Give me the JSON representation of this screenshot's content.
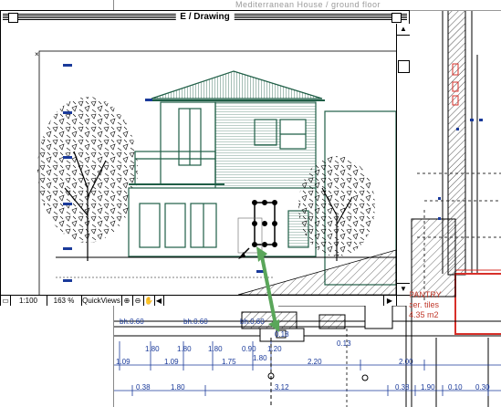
{
  "background_window": {
    "title": "Mediterranean House / ground floor"
  },
  "drawing_window": {
    "title": "E / Drawing"
  },
  "status_bar": {
    "scale": "1:100",
    "zoom": "163 %",
    "quickviews": "QuickViews",
    "zoom_in_icon": "magnifier-plus",
    "zoom_out_icon": "magnifier-minus",
    "pan_icon": "hand"
  },
  "room": {
    "name": "PANTRY",
    "finish": "cer. tiles",
    "area": "4.35 m2"
  },
  "plan_labels": {
    "bh1": "bh.0.60",
    "bh2": "bh.0.60",
    "bh3": "bh.0.60",
    "v180a": "1.80",
    "v180b": "1.80",
    "v180c": "1.80",
    "v090": "0.90",
    "v120": "1.20",
    "v180d": "1.80",
    "v018": "0.18",
    "v013": "0.13",
    "d109a": "1.09",
    "d109b": "1.09",
    "d175": "1.75",
    "d220": "2.20",
    "d200": "2.00",
    "d038a": "0.38",
    "d180": "1.80",
    "d312": "3.12",
    "d038b": "0.38",
    "d190": "1.90",
    "d010": "0.10",
    "d030": "0.30"
  },
  "colors": {
    "building_line": "#1f5e46",
    "arrow": "#5aa65a",
    "room_border": "#d7302a",
    "dimension": "#1a3a9a"
  }
}
